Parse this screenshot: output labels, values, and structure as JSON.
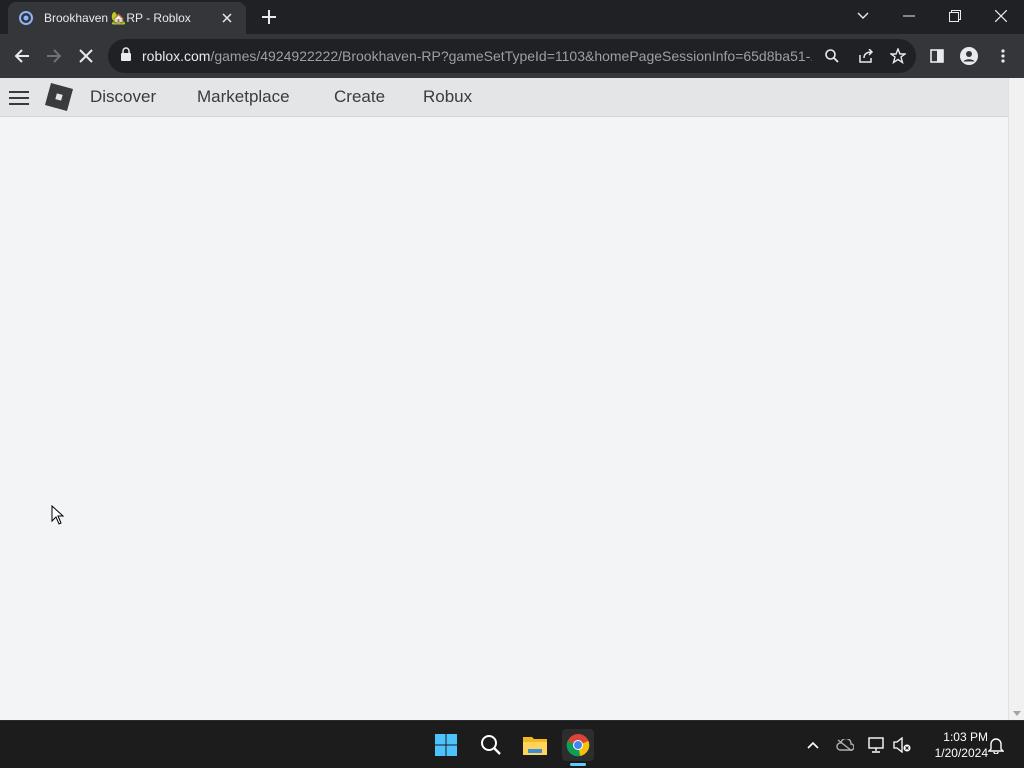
{
  "browser": {
    "tab": {
      "title": "Brookhaven 🏡RP - Roblox",
      "favicon": "roblox-loading-icon"
    },
    "address_bar": {
      "host": "roblox.com",
      "path": "/games/4924922222/Brookhaven-RP?gameSetTypeId=1103&homePageSessionInfo=65d8ba51-..."
    }
  },
  "roblox_nav": {
    "links": [
      "Discover",
      "Marketplace",
      "Create",
      "Robux"
    ]
  },
  "taskbar": {
    "time": "1:03 PM",
    "date": "1/20/2024"
  },
  "colors": {
    "chrome_dark": "#202124",
    "chrome_toolbar": "#35363a",
    "page_bg": "#f2f4f5",
    "nav_bg": "#e3e5e7",
    "taskbar_bg": "#1c1c1c",
    "windows_accent": "#60cdff"
  }
}
